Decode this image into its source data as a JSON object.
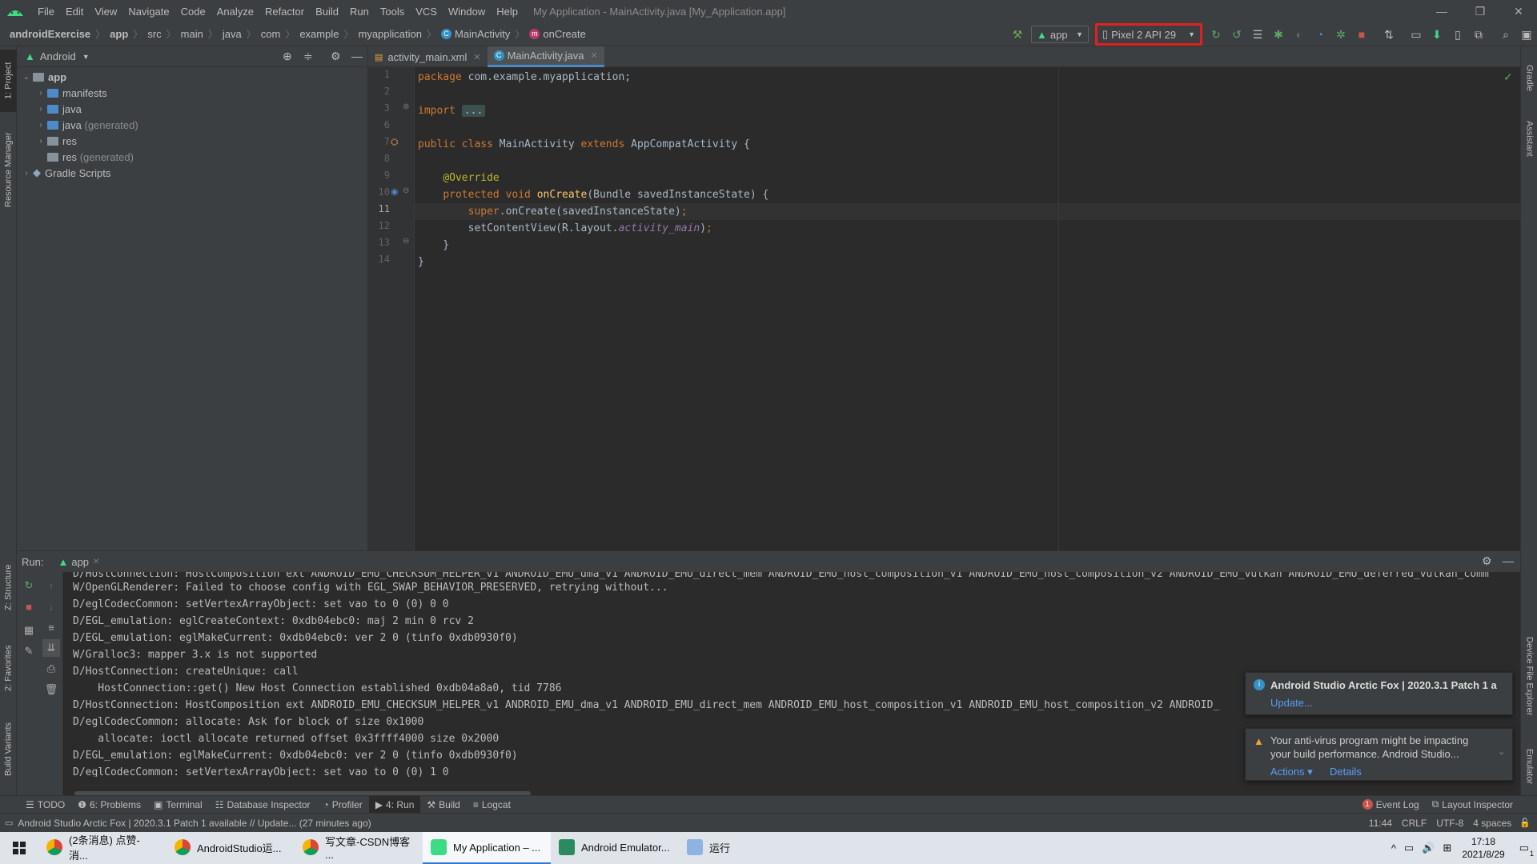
{
  "window": {
    "title": "My Application - MainActivity.java [My_Application.app]",
    "menu": [
      "File",
      "Edit",
      "View",
      "Navigate",
      "Code",
      "Analyze",
      "Refactor",
      "Build",
      "Run",
      "Tools",
      "VCS",
      "Window",
      "Help"
    ]
  },
  "breadcrumb": [
    "androidExercise",
    "app",
    "src",
    "main",
    "java",
    "com",
    "example",
    "myapplication",
    "MainActivity",
    "onCreate"
  ],
  "toolbar": {
    "run_config": "app",
    "device": "Pixel 2 API 29"
  },
  "left_stripe": [
    "1: Project",
    "Resource Manager",
    "Z: Structure",
    "2: Favorites",
    "Build Variants"
  ],
  "right_stripe": [
    "Gradle",
    "Assistant",
    "Device File Explorer",
    "Emulator"
  ],
  "project": {
    "view_mode": "Android",
    "tree": [
      {
        "label": "app",
        "note": "",
        "level": 0,
        "expanded": true
      },
      {
        "label": "manifests",
        "note": "",
        "level": 1,
        "expanded": false
      },
      {
        "label": "java",
        "note": "",
        "level": 1,
        "expanded": false
      },
      {
        "label": "java",
        "note": "(generated)",
        "level": 1,
        "expanded": false
      },
      {
        "label": "res",
        "note": "",
        "level": 1,
        "expanded": false
      },
      {
        "label": "res",
        "note": "(generated)",
        "level": 1,
        "expanded": false
      },
      {
        "label": "Gradle Scripts",
        "note": "",
        "level": 0,
        "expanded": false
      }
    ]
  },
  "editor": {
    "tabs": [
      {
        "label": "activity_main.xml",
        "active": false
      },
      {
        "label": "MainActivity.java",
        "active": true
      }
    ],
    "line_numbers": [
      "1",
      "2",
      "3",
      "6",
      "7",
      "8",
      "9",
      "10",
      "11",
      "12",
      "13",
      "14"
    ],
    "current_line": "11"
  },
  "run": {
    "label": "Run:",
    "tab": "app",
    "console": [
      "D/HostConnection: HostComposition ext ANDROID_EMU_CHECKSUM_HELPER_v1 ANDROID_EMU_dma_v1 ANDROID_EMU_direct_mem ANDROID_EMU_host_composition_v1 ANDROID_EMU_host_composition_v2 ANDROID_EMU_vulkan ANDROID_EMU_deferred_vulkan_comm",
      "W/OpenGLRenderer: Failed to choose config with EGL_SWAP_BEHAVIOR_PRESERVED, retrying without...",
      "D/eglCodecCommon: setVertexArrayObject: set vao to 0 (0) 0 0",
      "D/EGL_emulation: eglCreateContext: 0xdb04ebc0: maj 2 min 0 rcv 2",
      "D/EGL_emulation: eglMakeCurrent: 0xdb04ebc0: ver 2 0 (tinfo 0xdb0930f0)",
      "W/Gralloc3: mapper 3.x is not supported",
      "D/HostConnection: createUnique: call",
      "    HostConnection::get() New Host Connection established 0xdb04a8a0, tid 7786",
      "D/HostConnection: HostComposition ext ANDROID_EMU_CHECKSUM_HELPER_v1 ANDROID_EMU_dma_v1 ANDROID_EMU_direct_mem ANDROID_EMU_host_composition_v1 ANDROID_EMU_host_composition_v2 ANDROID_",
      "D/eglCodecCommon: allocate: Ask for block of size 0x1000",
      "    allocate: ioctl allocate returned offset 0x3ffff4000 size 0x2000",
      "D/EGL_emulation: eglMakeCurrent: 0xdb04ebc0: ver 2 0 (tinfo 0xdb0930f0)",
      "D/eglCodecCommon: setVertexArrayObject: set vao to 0 (0) 1 0"
    ]
  },
  "notifications": {
    "update": {
      "title": "Android Studio Arctic Fox | 2020.3.1 Patch 1 a",
      "link": "Update..."
    },
    "antivirus": {
      "text1": "Your anti-virus program might be impacting",
      "text2": "your build performance. Android Studio...",
      "actions": "Actions",
      "details": "Details"
    }
  },
  "bottom_tabs": [
    "TODO",
    "6: Problems",
    "Terminal",
    "Database Inspector",
    "Profiler",
    "4: Run",
    "Build",
    "Logcat"
  ],
  "bottom_right": [
    "Event Log",
    "Layout Inspector"
  ],
  "event_count": "1",
  "status": {
    "message": "Android Studio Arctic Fox | 2020.3.1 Patch 1 available // Update... (27 minutes ago)",
    "position": "11:44",
    "line_sep": "CRLF",
    "encoding": "UTF-8",
    "indent": "4 spaces"
  },
  "taskbar": {
    "tasks": [
      "(2条消息) 点赞-消...",
      "AndroidStudio运...",
      "写文章-CSDN博客 ...",
      "My Application – ...",
      "Android Emulator...",
      "运行"
    ],
    "time": "17:18",
    "date": "2021/8/29",
    "notif_count": "1"
  },
  "colors": {
    "accent": "#4a88c7",
    "highlight_box": "#e32020",
    "android_green": "#3ddc84"
  }
}
